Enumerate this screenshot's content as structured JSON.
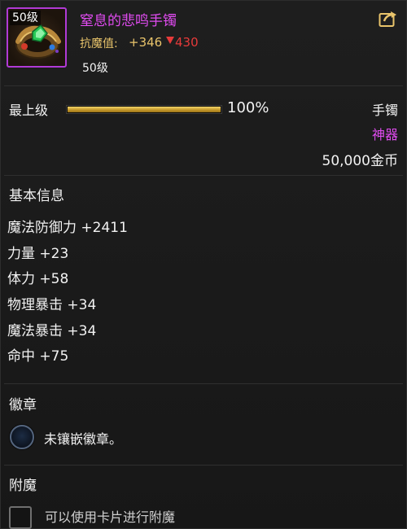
{
  "item": {
    "level_badge": "50级",
    "name": "窒息的悲鸣手镯",
    "resist_label": "抗魔值:",
    "resist_value": "+346",
    "resist_down": "430",
    "required_level": "50级",
    "icon_name": "bracelet-icon"
  },
  "upgrade": {
    "label": "最上级",
    "progress_percent": 100,
    "progress_text": "100%"
  },
  "meta": {
    "type": "手镯",
    "grade": "神器",
    "price": "50,000金币"
  },
  "basic_info": {
    "title": "基本信息",
    "stats": [
      "魔法防御力 +2411",
      "力量 +23",
      "体力 +58",
      "物理暴击 +34",
      "魔法暴击 +34",
      "命中 +75"
    ]
  },
  "badge": {
    "title": "徽章",
    "slot_text": "未镶嵌徽章。"
  },
  "enchant": {
    "title": "附魔",
    "text": "可以使用卡片进行附魔"
  },
  "colors": {
    "legendary_purple": "#e04bf0",
    "resist_gold": "#e9c46b",
    "decrease_red": "#e63a3a",
    "progress_gold": "#c79b2c"
  }
}
